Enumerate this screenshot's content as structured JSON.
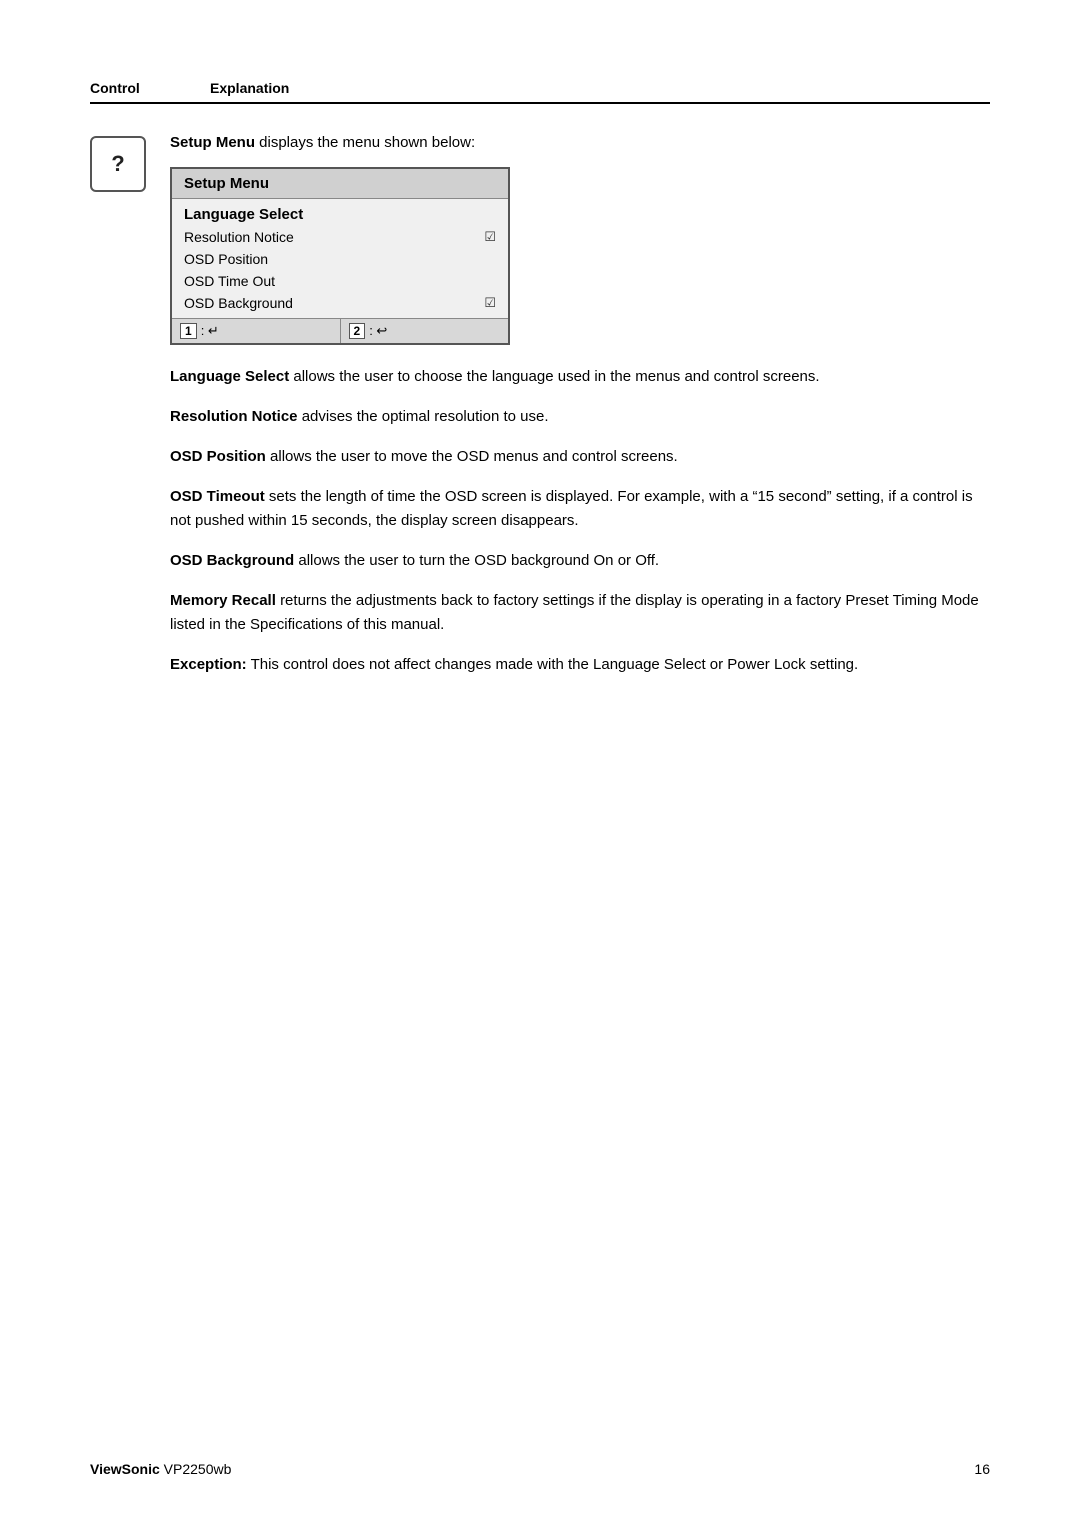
{
  "header": {
    "control_label": "Control",
    "explanation_label": "Explanation"
  },
  "icon": {
    "symbol": "?"
  },
  "intro": {
    "text_bold": "Setup Menu",
    "text_rest": " displays the menu shown below:"
  },
  "setup_menu": {
    "title": "Setup Menu",
    "items": [
      {
        "label": "Language Select",
        "selected": true,
        "has_check": false
      },
      {
        "label": "Resolution Notice",
        "selected": false,
        "has_check": true
      },
      {
        "label": "OSD Position",
        "selected": false,
        "has_check": false
      },
      {
        "label": "OSD Time Out",
        "selected": false,
        "has_check": false
      },
      {
        "label": "OSD Background",
        "selected": false,
        "has_check": true
      }
    ],
    "footer_buttons": [
      {
        "num": "1",
        "icon": "↵"
      },
      {
        "num": "2",
        "icon": "↩"
      }
    ]
  },
  "descriptions": [
    {
      "bold": "Language Select",
      "rest": " allows the user to choose the language used in the menus and control screens."
    },
    {
      "bold": "Resolution Notice",
      "rest": " advises the optimal resolution to use."
    },
    {
      "bold": "OSD Position",
      "rest": " allows the user to move the OSD menus and control screens."
    },
    {
      "bold": "OSD Timeout",
      "rest": " sets the length of time the OSD screen is displayed. For example, with a “15 second” setting, if a control is not pushed within 15 seconds, the display screen disappears."
    },
    {
      "bold": "OSD Background",
      "rest": " allows the user to turn the OSD background On or Off."
    },
    {
      "bold": "Memory Recall",
      "rest": " returns the adjustments back to factory settings if the display is operating in a factory Preset Timing Mode listed in the Specifications of this manual."
    },
    {
      "bold": "Exception:",
      "rest": " This control does not affect changes made with the Language Select or Power Lock setting."
    }
  ],
  "footer": {
    "brand": "ViewSonic",
    "model": "VP2250wb",
    "page_number": "16"
  }
}
